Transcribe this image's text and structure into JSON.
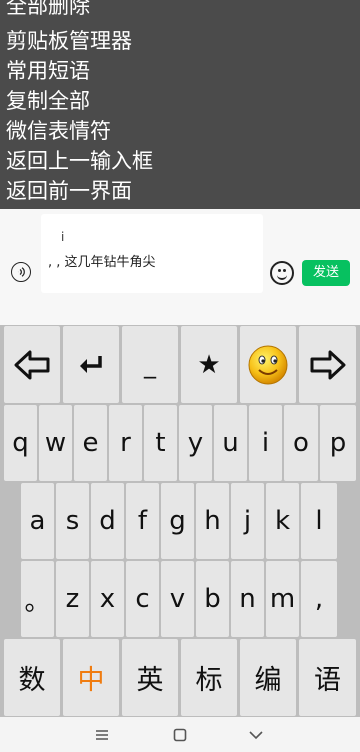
{
  "menu": {
    "items": [
      "全部删除",
      "剪贴板管理器",
      "常用短语",
      "复制全部",
      "微信表情符",
      "返回上一输入框",
      "返回前一界面"
    ]
  },
  "chat": {
    "input_line1": "i",
    "input_line2": ", , 这几年钻牛角尖",
    "send_label": "发送",
    "send_color": "#07c160"
  },
  "keyboard": {
    "function_row": [
      {
        "name": "left-arrow-icon",
        "glyph": ""
      },
      {
        "name": "enter-icon",
        "glyph": "↵"
      },
      {
        "name": "underscore-key",
        "glyph": "_"
      },
      {
        "name": "star-key",
        "glyph": "★"
      },
      {
        "name": "smiley-emoji-icon",
        "glyph": ""
      },
      {
        "name": "right-arrow-icon",
        "glyph": ""
      }
    ],
    "row1": [
      "q",
      "w",
      "e",
      "r",
      "t",
      "y",
      "u",
      "i",
      "o",
      "p"
    ],
    "row2": [
      "a",
      "s",
      "d",
      "f",
      "g",
      "h",
      "j",
      "k",
      "l"
    ],
    "row3": [
      "。",
      "z",
      "x",
      "c",
      "v",
      "b",
      "n",
      "m",
      ","
    ],
    "bottom_row": [
      "数",
      "中",
      "英",
      "标",
      "编",
      "语"
    ],
    "active_mode": "中",
    "active_color": "#f07c10"
  },
  "navbar": {
    "icons": [
      "menu-icon",
      "home-icon",
      "back-icon"
    ]
  }
}
